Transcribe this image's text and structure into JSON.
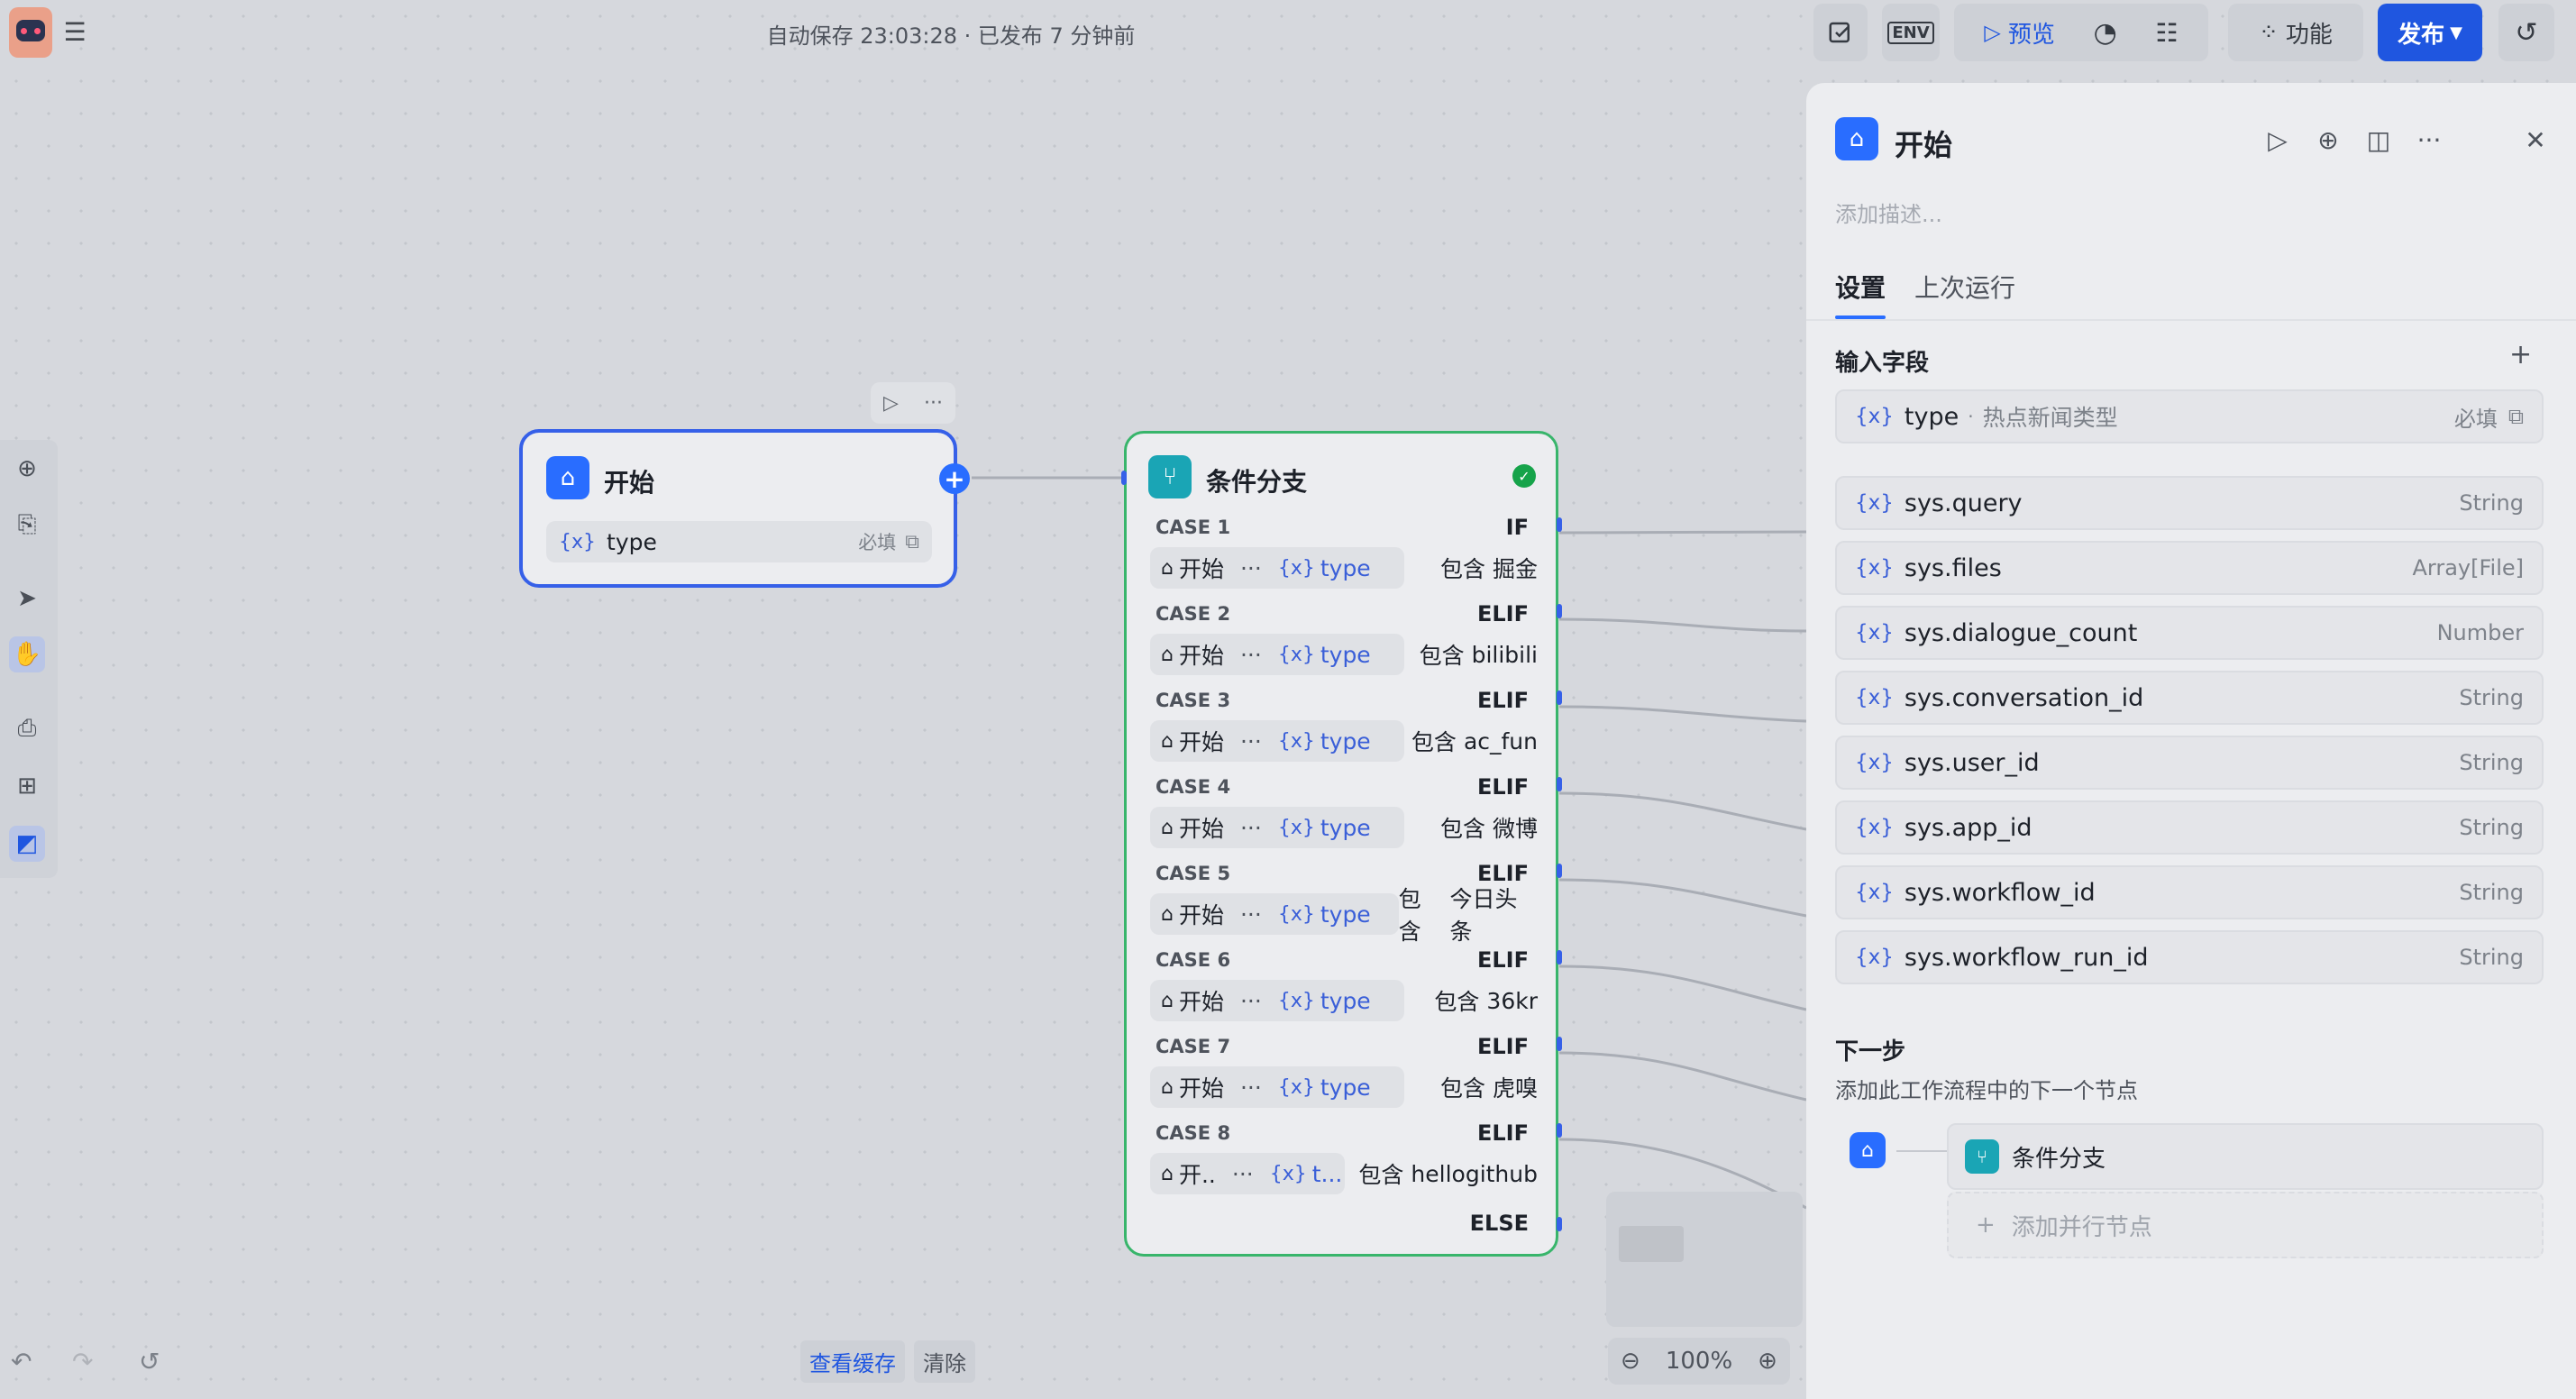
{
  "topbar": {
    "save_status": "自动保存 23:03:28 · 已发布 7 分钟前",
    "env_label": "ENV",
    "preview_label": "预览",
    "features_label": "功能",
    "publish_label": "发布"
  },
  "start_node": {
    "title": "开始",
    "var_name": "type",
    "required_label": "必填"
  },
  "condition_node": {
    "title": "条件分支",
    "cases": [
      {
        "label": "CASE 1",
        "kw": "IF",
        "source": "开始",
        "var": "type",
        "op": "包含",
        "value": "掘金"
      },
      {
        "label": "CASE 2",
        "kw": "ELIF",
        "source": "开始",
        "var": "type",
        "op": "包含",
        "value": "bilibili"
      },
      {
        "label": "CASE 3",
        "kw": "ELIF",
        "source": "开始",
        "var": "type",
        "op": "包含",
        "value": "ac_fun"
      },
      {
        "label": "CASE 4",
        "kw": "ELIF",
        "source": "开始",
        "var": "type",
        "op": "包含",
        "value": "微博"
      },
      {
        "label": "CASE 5",
        "kw": "ELIF",
        "source": "开始",
        "var": "type",
        "op": "包含",
        "value": "今日头条"
      },
      {
        "label": "CASE 6",
        "kw": "ELIF",
        "source": "开始",
        "var": "type",
        "op": "包含",
        "value": "36kr"
      },
      {
        "label": "CASE 7",
        "kw": "ELIF",
        "source": "开始",
        "var": "type",
        "op": "包含",
        "value": "虎嗅"
      },
      {
        "label": "CASE 8",
        "kw": "ELIF",
        "source": "开..",
        "var": "t...",
        "op": "包含",
        "value": "hellogithub"
      }
    ],
    "ellipsis": "···",
    "else_label": "ELSE"
  },
  "bottom": {
    "view_cache": "查看缓存",
    "clear": "清除",
    "zoom": "100%"
  },
  "panel": {
    "title": "开始",
    "description_placeholder": "添加描述...",
    "tabs": [
      "设置",
      "上次运行"
    ],
    "input_section": "输入字段",
    "input_fields": [
      {
        "name": "type",
        "desc": "热点新闻类型",
        "badge": "必填"
      }
    ],
    "system_fields": [
      {
        "name": "sys.query",
        "type": "String"
      },
      {
        "name": "sys.files",
        "type": "Array[File]"
      },
      {
        "name": "sys.dialogue_count",
        "type": "Number"
      },
      {
        "name": "sys.conversation_id",
        "type": "String"
      },
      {
        "name": "sys.user_id",
        "type": "String"
      },
      {
        "name": "sys.app_id",
        "type": "String"
      },
      {
        "name": "sys.workflow_id",
        "type": "String"
      },
      {
        "name": "sys.workflow_run_id",
        "type": "String"
      }
    ],
    "next_section": "下一步",
    "next_desc": "添加此工作流程中的下一个节点",
    "next_node": "条件分支",
    "add_parallel": "添加并行节点"
  },
  "colors": {
    "accent": "#296dff",
    "condition": "#1aa5b5",
    "success": "#16a34a"
  }
}
